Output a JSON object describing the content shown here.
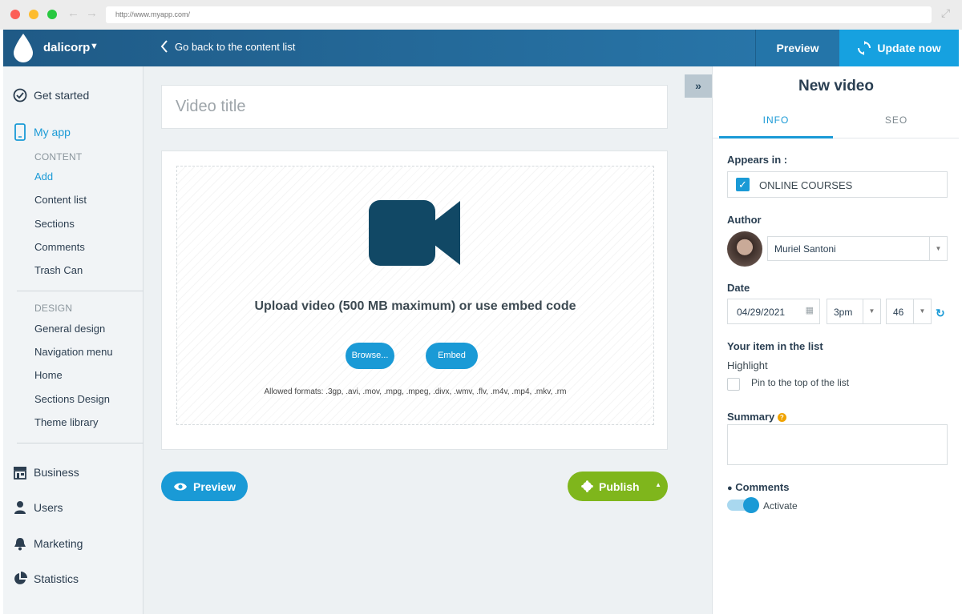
{
  "browser": {
    "url": "http://www.myapp.com/"
  },
  "topbar": {
    "org_name": "dalicorp",
    "back_label": "Go back to the content list",
    "preview_label": "Preview",
    "update_label": "Update now"
  },
  "sidebar": {
    "get_started": "Get started",
    "my_app": "My app",
    "content_section": "CONTENT",
    "content_items": [
      "Add",
      "Content list",
      "Sections",
      "Comments",
      "Trash Can"
    ],
    "design_section": "DESIGN",
    "design_items": [
      "General design",
      "Navigation menu",
      "Home",
      "Sections Design",
      "Theme library"
    ],
    "business": "Business",
    "users": "Users",
    "marketing": "Marketing",
    "statistics": "Statistics"
  },
  "editor": {
    "title_placeholder": "Video title",
    "upload_text": "Upload video (500 MB maximum) or use embed code",
    "browse_label": "Browse...",
    "embed_label": "Embed",
    "formats": "Allowed formats: .3gp, .avi, .mov, .mpg, .mpeg, .divx, .wmv, .flv, .m4v, .mp4, .mkv, .rm",
    "preview_label": "Preview",
    "publish_label": "Publish"
  },
  "panel": {
    "title": "New video",
    "tabs": [
      "INFO",
      "SEO"
    ],
    "appears_in_label": "Appears in :",
    "appears_in_value": "ONLINE COURSES",
    "author_label": "Author",
    "author_name": "Muriel Santoni",
    "date_label": "Date",
    "date_value": "04/29/2021",
    "hour_value": "3pm",
    "minute_value": "46",
    "list_label": "Your item in the list",
    "highlight_label": "Highlight",
    "pin_label": "Pin to the top of the list",
    "summary_label": "Summary",
    "comments_label": "Comments",
    "activate_label": "Activate"
  },
  "colors": {
    "accent": "#1a9ad6",
    "publish": "#7fb61c",
    "navy": "#1f5a86"
  }
}
